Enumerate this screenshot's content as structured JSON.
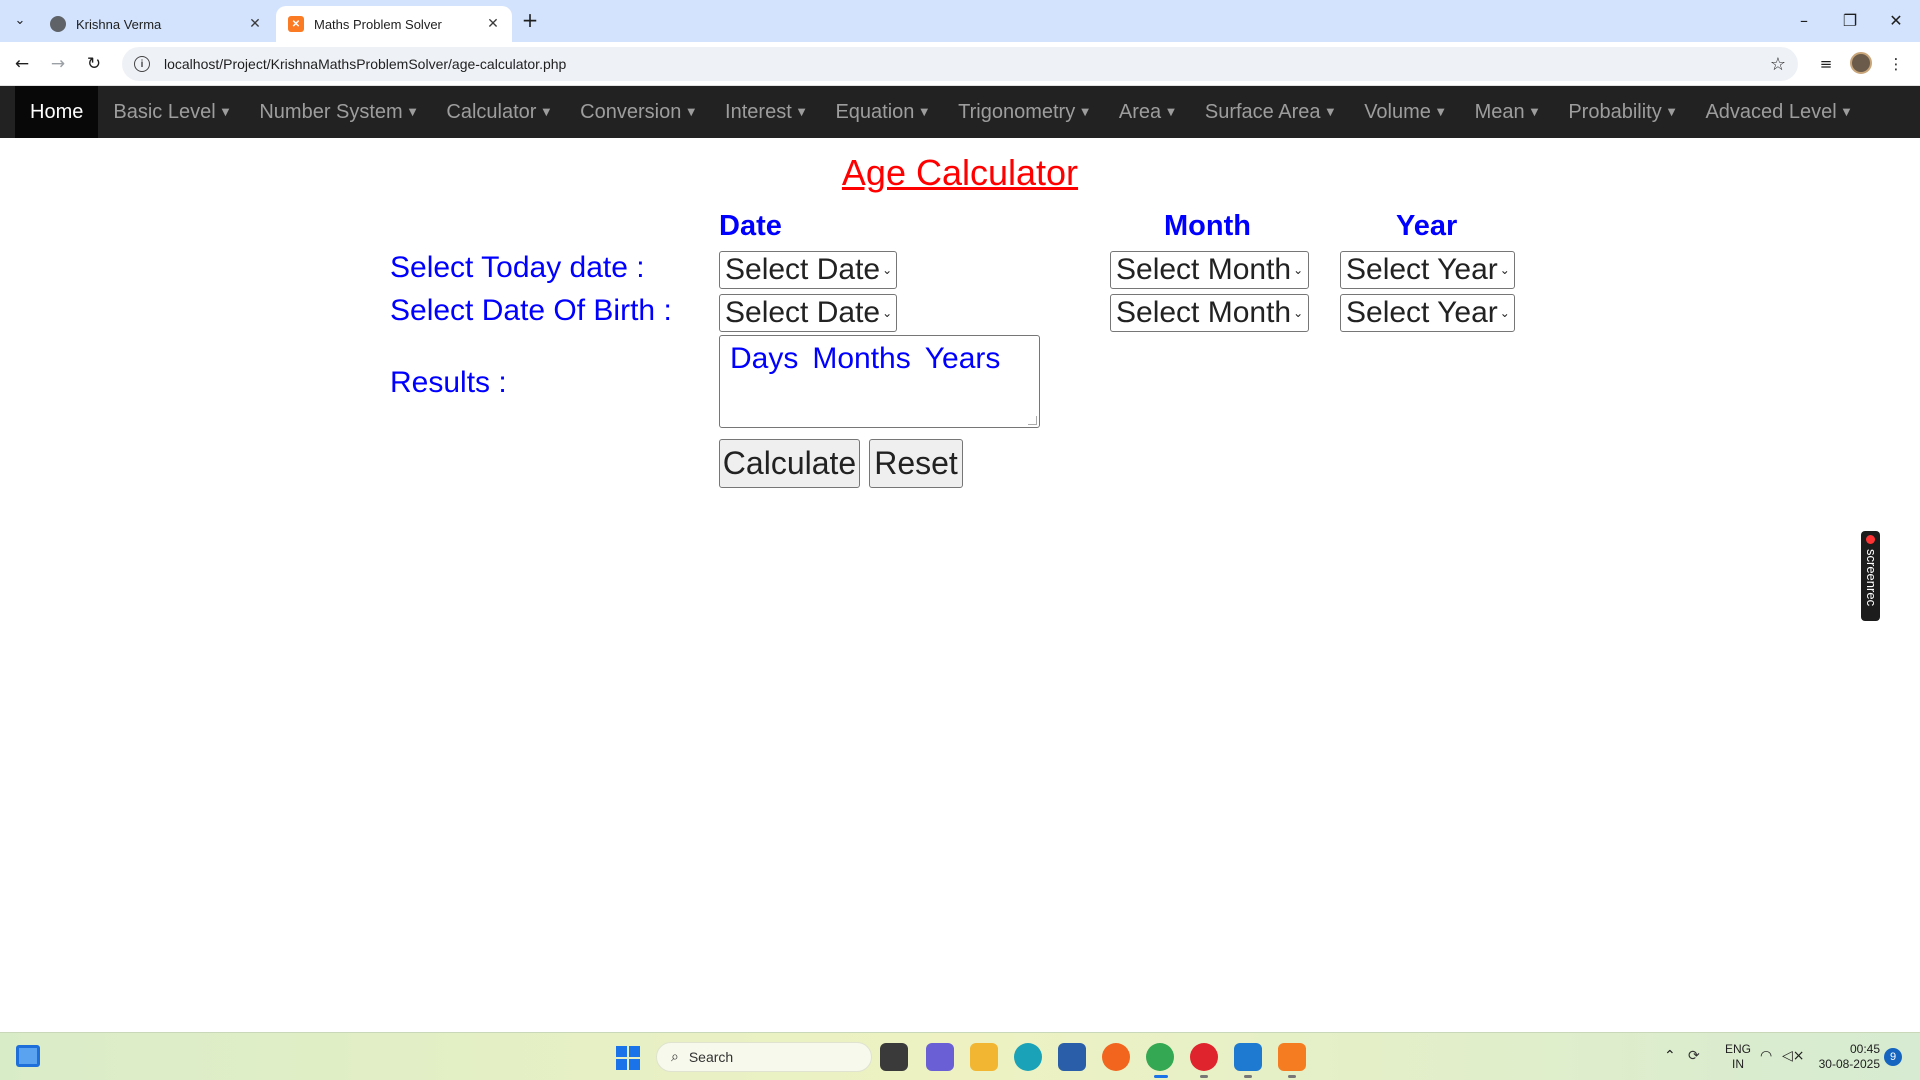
{
  "browser": {
    "tabs": [
      {
        "title": "Krishna Verma",
        "active": false
      },
      {
        "title": "Maths Problem Solver",
        "active": true
      }
    ],
    "url": "localhost/Project/KrishnaMathsProblemSolver/age-calculator.php"
  },
  "navbar": {
    "items": [
      {
        "label": "Home",
        "active": true,
        "dropdown": false
      },
      {
        "label": "Basic Level",
        "dropdown": true
      },
      {
        "label": "Number System",
        "dropdown": true
      },
      {
        "label": "Calculator",
        "dropdown": true
      },
      {
        "label": "Conversion",
        "dropdown": true
      },
      {
        "label": "Interest",
        "dropdown": true
      },
      {
        "label": "Equation",
        "dropdown": true
      },
      {
        "label": "Trigonometry",
        "dropdown": true
      },
      {
        "label": "Area",
        "dropdown": true
      },
      {
        "label": "Surface Area",
        "dropdown": true
      },
      {
        "label": "Volume",
        "dropdown": true
      },
      {
        "label": "Mean",
        "dropdown": true
      },
      {
        "label": "Probability",
        "dropdown": true
      },
      {
        "label": "Advaced Level",
        "dropdown": true
      }
    ]
  },
  "page": {
    "title": "Age Calculator",
    "columns": {
      "date": "Date",
      "month": "Month",
      "year": "Year"
    },
    "rows": [
      {
        "label": "Select Today date :",
        "date": "Select Date",
        "month": "Select Month",
        "year": "Select Year"
      },
      {
        "label": "Select Date Of Birth :",
        "date": "Select Date",
        "month": "Select Month",
        "year": "Select Year"
      }
    ],
    "results_label": "Results :",
    "results": {
      "days": "Days",
      "months": "Months",
      "years": "Years"
    },
    "calculate_label": "Calculate",
    "reset_label": "Reset"
  },
  "overlay": {
    "screenrec_label": "screenrec"
  },
  "taskbar": {
    "search_placeholder": "Search",
    "lang_top": "ENG",
    "lang_bottom": "IN",
    "time": "00:45",
    "date": "30-08-2025",
    "notification_count": "9"
  },
  "colors": {
    "navbar_bg": "#222222",
    "title_red": "#ff0000",
    "label_blue": "#0000ff",
    "tab_strip": "#d3e3fd"
  }
}
